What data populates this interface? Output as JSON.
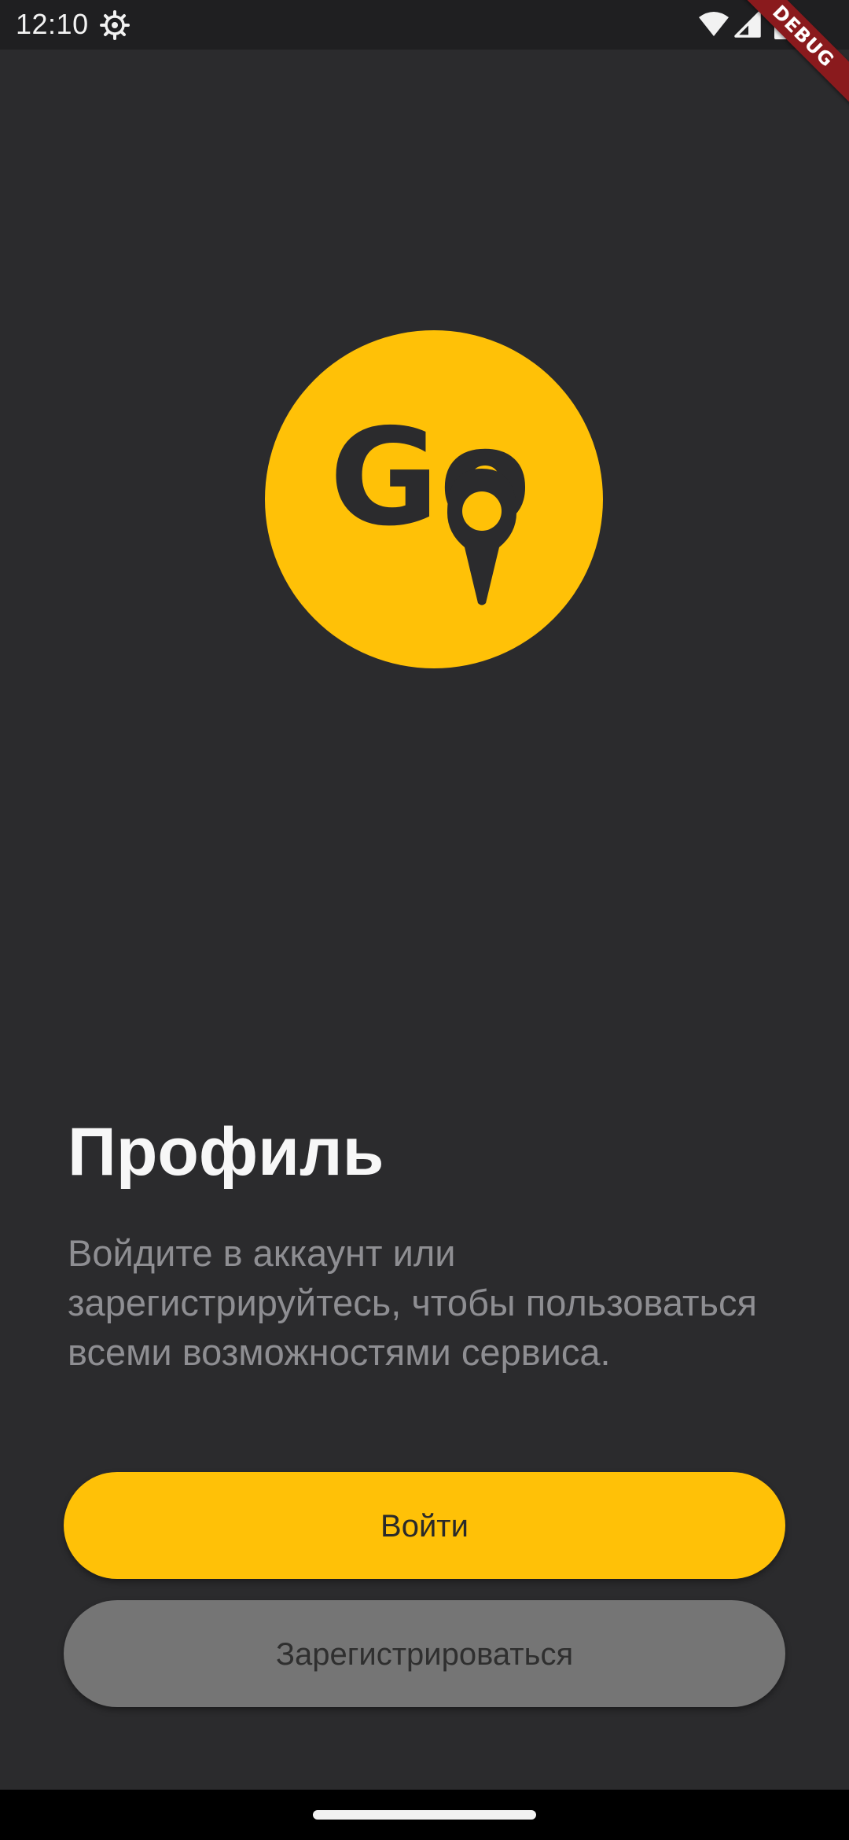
{
  "status_bar": {
    "time": "12:10",
    "icons": [
      "settings-gear-icon",
      "wifi-icon",
      "cell-signal-icon",
      "battery-icon"
    ]
  },
  "debug_banner": {
    "label": "DEBUG"
  },
  "logo": {
    "text": "Go",
    "icon": "map-pin-icon",
    "background_color": "#ffc107",
    "foreground_color": "#2b2b2d"
  },
  "profile": {
    "title": "Профиль",
    "description": "Войдите в аккаунт или зарегистрируйтесь, чтобы пользоваться всеми возможностями сервиса."
  },
  "actions": {
    "login_label": "Войти",
    "register_label": "Зарегистрироваться"
  },
  "colors": {
    "background": "#2b2b2d",
    "accent": "#ffc107",
    "secondary_button": "#757575",
    "description_text": "#8e8e92"
  }
}
